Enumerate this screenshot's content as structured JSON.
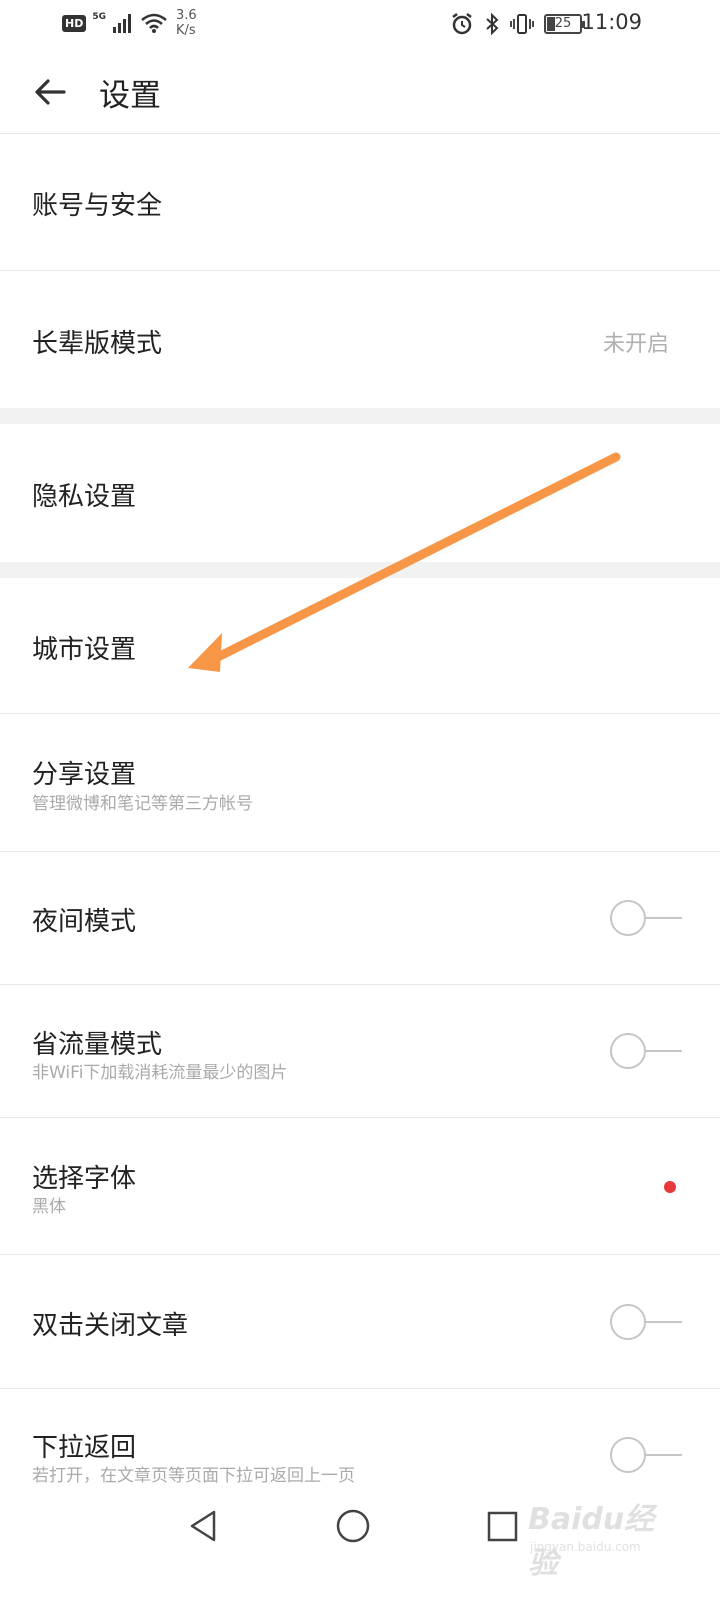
{
  "status_bar": {
    "hd": "HD",
    "network": "5G",
    "speed_value": "3.6",
    "speed_unit": "K/s",
    "battery": "25",
    "time": "11:09"
  },
  "header": {
    "title": "设置",
    "back_icon": "back-arrow-icon"
  },
  "settings": {
    "account": {
      "title": "账号与安全"
    },
    "elder_mode": {
      "title": "长辈版模式",
      "value": "未开启"
    },
    "privacy": {
      "title": "隐私设置"
    },
    "city": {
      "title": "城市设置"
    },
    "share": {
      "title": "分享设置",
      "subtitle": "管理微博和笔记等第三方帐号"
    },
    "night_mode": {
      "title": "夜间模式",
      "enabled": false
    },
    "data_saver": {
      "title": "省流量模式",
      "subtitle": "非WiFi下加载消耗流量最少的图片",
      "enabled": false
    },
    "font": {
      "title": "选择字体",
      "subtitle": "黑体",
      "new_badge": true
    },
    "double_tap_close": {
      "title": "双击关闭文章",
      "enabled": false
    },
    "pull_back": {
      "title": "下拉返回",
      "subtitle": "若打开，在文章页等页面下拉可返回上一页",
      "enabled": false
    }
  },
  "colors": {
    "annotation_arrow": "#f79646",
    "badge_dot": "#e8383d",
    "toggle_off": "#c6c6c6"
  },
  "watermark": {
    "brand": "Baidu经验",
    "domain": "jingyan.baidu.com"
  }
}
